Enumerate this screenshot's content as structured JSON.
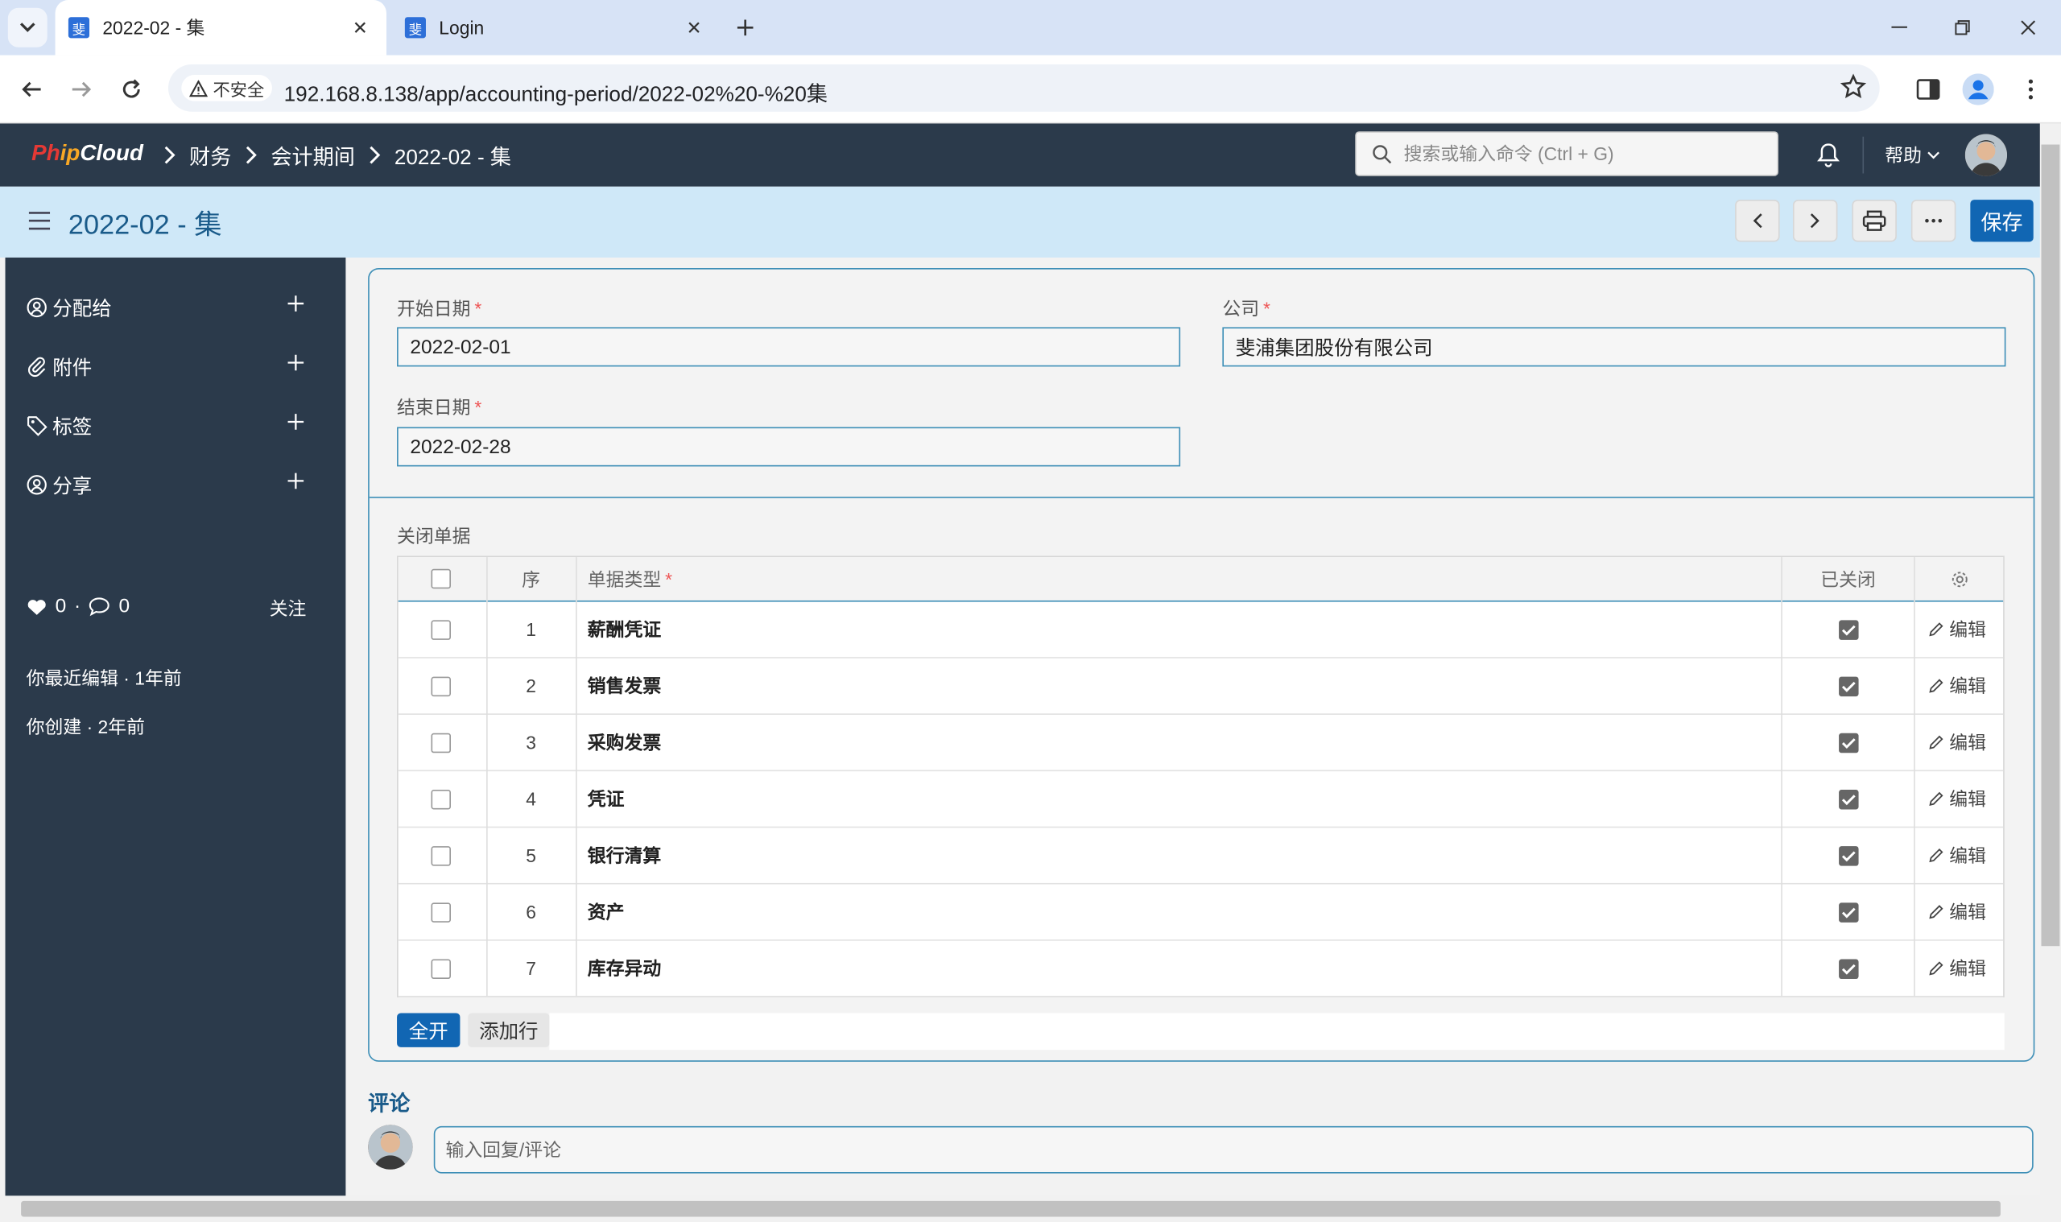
{
  "browser": {
    "tabs": [
      {
        "title": "2022-02 - 集",
        "active": true,
        "favicon": "phipcloud-favicon"
      },
      {
        "title": "Login",
        "active": false,
        "favicon": "phipcloud-favicon"
      }
    ],
    "security_label": "不安全",
    "url": "192.168.8.138/app/accounting-period/2022-02%20-%20集"
  },
  "navbar": {
    "logo": {
      "part1": "Ph",
      "part2": "ip",
      "part3": "Cloud"
    },
    "breadcrumbs": [
      "财务",
      "会计期间",
      "2022-02 - 集"
    ],
    "search_placeholder": "搜索或输入命令 (Ctrl + G)",
    "help_label": "帮助"
  },
  "page": {
    "title": "2022-02 - 集",
    "save_label": "保存"
  },
  "sidebar": {
    "items": [
      {
        "label": "分配给",
        "icon": "assign-icon"
      },
      {
        "label": "附件",
        "icon": "attachment-icon"
      },
      {
        "label": "标签",
        "icon": "tag-icon"
      },
      {
        "label": "分享",
        "icon": "share-icon"
      }
    ],
    "likes": "0",
    "comments_count": "0",
    "follow_label": "关注",
    "last_edit": "你最近编辑 · 1年前",
    "created": "你创建 · 2年前"
  },
  "form": {
    "start_date": {
      "label": "开始日期",
      "value": "2022-02-01"
    },
    "company": {
      "label": "公司",
      "value": "斐浦集团股份有限公司"
    },
    "end_date": {
      "label": "结束日期",
      "value": "2022-02-28"
    },
    "required_mark": "*"
  },
  "closed_docs": {
    "section_label": "关闭单据",
    "headers": {
      "idx": "序",
      "doc_type": "单据类型",
      "closed": "已关闭"
    },
    "edit_label": "编辑",
    "rows": [
      {
        "idx": "1",
        "doc_type": "薪酬凭证",
        "closed": true
      },
      {
        "idx": "2",
        "doc_type": "销售发票",
        "closed": true
      },
      {
        "idx": "3",
        "doc_type": "采购发票",
        "closed": true
      },
      {
        "idx": "4",
        "doc_type": "凭证",
        "closed": true
      },
      {
        "idx": "5",
        "doc_type": "银行清算",
        "closed": true
      },
      {
        "idx": "6",
        "doc_type": "资产",
        "closed": true
      },
      {
        "idx": "7",
        "doc_type": "库存异动",
        "closed": true
      }
    ],
    "open_all_label": "全开",
    "add_row_label": "添加行"
  },
  "comments": {
    "title": "评论",
    "placeholder": "输入回复/评论"
  },
  "colors": {
    "navbar_bg": "#2b3a4b",
    "header_bg": "#cfe8f8",
    "accent": "#1166b3",
    "border_accent": "#3e8fb7"
  }
}
